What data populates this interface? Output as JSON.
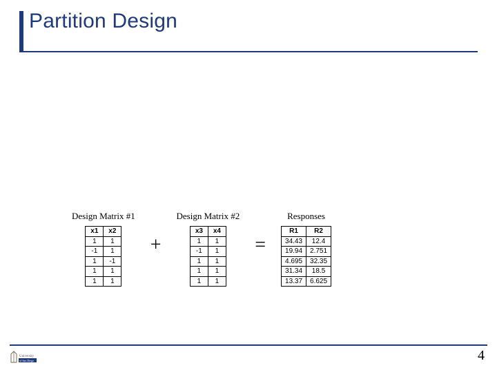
{
  "title": "Partition Design",
  "page_number": "4",
  "operators": {
    "plus": "+",
    "equals": "="
  },
  "matrix1": {
    "caption": "Design Matrix #1",
    "headers": [
      "x1",
      "x2"
    ],
    "rows": [
      [
        "1",
        "1"
      ],
      [
        "-1",
        "1"
      ],
      [
        "1",
        "-1"
      ],
      [
        "1",
        "1"
      ],
      [
        "1",
        "1"
      ]
    ]
  },
  "matrix2": {
    "caption": "Design Matrix #2",
    "headers": [
      "x3",
      "x4"
    ],
    "rows": [
      [
        "1",
        "1"
      ],
      [
        "-1",
        "1"
      ],
      [
        "1",
        "1"
      ],
      [
        "1",
        "1"
      ],
      [
        "1",
        "1"
      ]
    ]
  },
  "responses": {
    "caption": "Responses",
    "headers": [
      "R1",
      "R2"
    ],
    "rows": [
      [
        "34.43",
        "12.4"
      ],
      [
        "19.94",
        "2.751"
      ],
      [
        "4.695",
        "32.35"
      ],
      [
        "31.34",
        "18.5"
      ],
      [
        "13.37",
        "6.625"
      ]
    ]
  },
  "logo_alt": "University of San Diego"
}
